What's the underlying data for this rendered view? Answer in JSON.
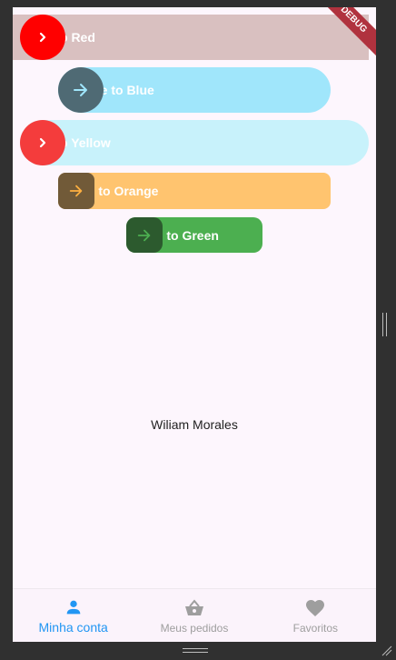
{
  "sliders": [
    {
      "id": "red",
      "label": "o Red",
      "bar_color": "#d9c0c0",
      "thumb_color": "#ff0000",
      "icon": "chevron-right-icon"
    },
    {
      "id": "blue",
      "label": "Swipe to Blue",
      "bar_color": "#a0e6fb",
      "thumb_color": "#4f6a74",
      "icon": "arrow-right-icon"
    },
    {
      "id": "yellow",
      "label": "o Yellow",
      "bar_color": "#c8f2fb",
      "thumb_color": "#f43c3c",
      "icon": "chevron-right-icon"
    },
    {
      "id": "orange",
      "label": "Swipe to Orange",
      "bar_color": "#ffc46f",
      "thumb_color": "#715a38",
      "icon": "arrow-right-icon"
    },
    {
      "id": "green",
      "label": "Swipe to Green",
      "bar_color": "#4caf50",
      "thumb_color": "#2c5a2e",
      "icon": "arrow-right-icon"
    }
  ],
  "center_text": "Wiliam Morales",
  "debug_banner": "DEBUG",
  "bottom_nav": {
    "items": [
      {
        "label": "Minha conta",
        "icon": "person-icon",
        "active": true
      },
      {
        "label": "Meus pedidos",
        "icon": "basket-icon",
        "active": false
      },
      {
        "label": "Favoritos",
        "icon": "heart-icon",
        "active": false
      }
    ],
    "active_color": "#2196f3",
    "inactive_color": "#9e9e9e"
  }
}
